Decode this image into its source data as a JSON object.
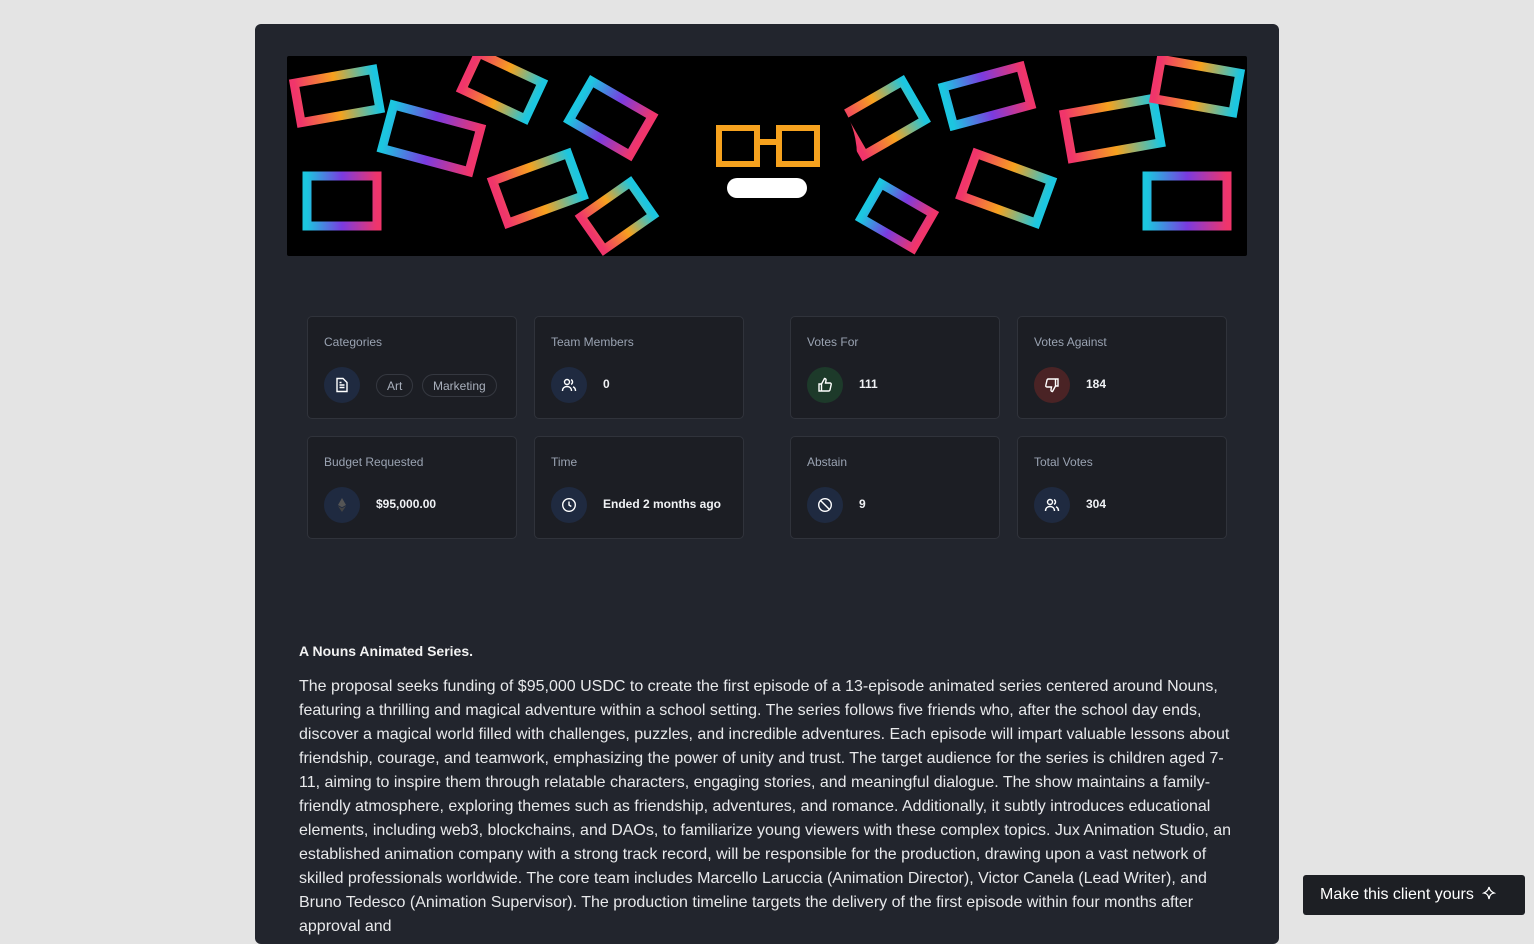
{
  "banner": {
    "alt": "Nouns glasses artwork"
  },
  "cards": [
    {
      "label": "Categories",
      "icon": "document-icon",
      "chips": [
        "Art",
        "Marketing"
      ]
    },
    {
      "label": "Team Members",
      "icon": "users-icon",
      "value": "0"
    },
    {
      "label": "Votes For",
      "icon": "thumbs-up-icon",
      "value": "111"
    },
    {
      "label": "Votes Against",
      "icon": "thumbs-down-icon",
      "value": "184"
    },
    {
      "label": "Budget Requested",
      "icon": "ethereum-icon",
      "value": "$95,000.00"
    },
    {
      "label": "Time",
      "icon": "clock-icon",
      "value": "Ended 2 months ago"
    },
    {
      "label": "Abstain",
      "icon": "ban-icon",
      "value": "9"
    },
    {
      "label": "Total Votes",
      "icon": "users-icon",
      "value": "304"
    }
  ],
  "proposal": {
    "title": "A Nouns Animated Series.",
    "description": "The proposal seeks funding of $95,000 USDC to create the first episode of a 13-episode animated series centered around Nouns, featuring a thrilling and magical adventure within a school setting. The series follows five friends who, after the school day ends, discover a magical world filled with challenges, puzzles, and incredible adventures. Each episode will impart valuable lessons about friendship, courage, and teamwork, emphasizing the power of unity and trust. The target audience for the series is children aged 7-11, aiming to inspire them through relatable characters, engaging stories, and meaningful dialogue. The show maintains a family-friendly atmosphere, exploring themes such as friendship, adventures, and romance. Additionally, it subtly introduces educational elements, including web3, blockchains, and DAOs, to familiarize young viewers with these complex topics. Jux Animation Studio, an established animation company with a strong track record, will be responsible for the production, drawing upon a vast network of skilled professionals worldwide. The core team includes Marcello Laruccia (Animation Director), Victor Canela (Lead Writer), and Bruno Tedesco (Animation Supervisor). The production timeline targets the delivery of the first episode within four months after approval and"
  },
  "cta": {
    "label": "Make this client yours",
    "icon": "sparkle-icon"
  },
  "colors": {
    "for_bg": "#1d3a2a",
    "against_bg": "#4a2325",
    "icon_bg": "#1f2a40"
  }
}
